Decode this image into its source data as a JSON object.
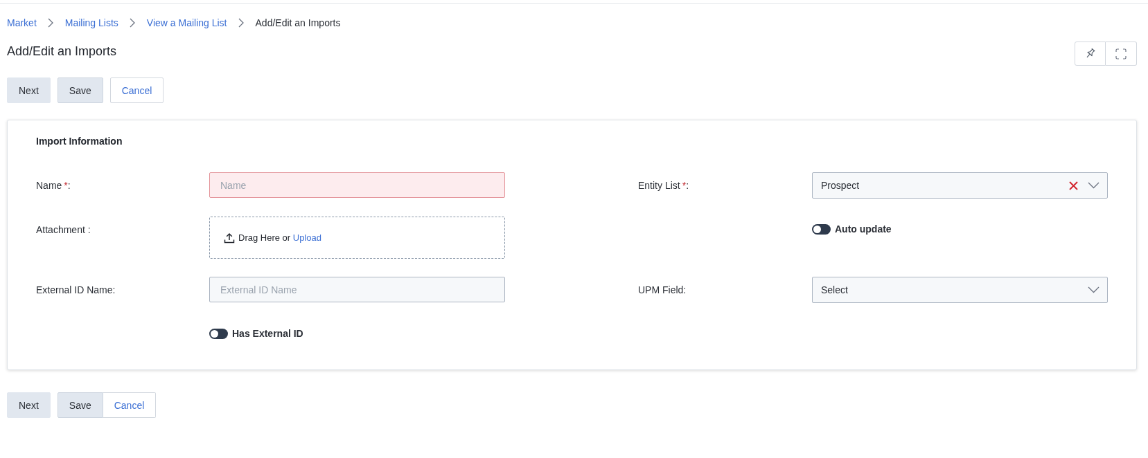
{
  "breadcrumb": [
    {
      "label": "Market",
      "current": false
    },
    {
      "label": "Mailing Lists",
      "current": false
    },
    {
      "label": "View a Mailing List",
      "current": false
    },
    {
      "label": "Add/Edit an Imports",
      "current": true
    }
  ],
  "page_title": "Add/Edit an Imports",
  "top_actions": [
    {
      "label": "Next",
      "kind": "plain"
    },
    {
      "label": "Save",
      "kind": "secondary"
    },
    {
      "label": "Cancel",
      "kind": "outline"
    }
  ],
  "form": {
    "title": "Import Information",
    "rows": [
      [
        {
          "kind": "text",
          "label": "Name",
          "required_mark": "*",
          "label_end": ":",
          "placeholder": "Name",
          "invalid": true
        },
        {
          "kind": "select",
          "label": "Entity List",
          "required_mark": "*",
          "label_end": ":",
          "value": "Prospect",
          "clearable": true
        }
      ],
      [
        {
          "kind": "upload",
          "label": "Attachment :",
          "prompt": "Drag Here or",
          "link": "Upload"
        },
        {
          "kind": "toggle",
          "label": "Auto update",
          "on": false
        }
      ],
      [
        {
          "kind": "text",
          "label": "External ID Name:",
          "placeholder": "External ID Name",
          "invalid": false
        },
        {
          "kind": "select",
          "label": "UPM Field:",
          "value": "Select",
          "clearable": false
        }
      ],
      [
        {
          "kind": "toggle",
          "label": "Has External ID",
          "on": false
        }
      ]
    ]
  },
  "bottom_actions": [
    {
      "label": "Next",
      "kind": "plain"
    },
    {
      "kind": "group",
      "buttons": [
        {
          "label": "Save",
          "kind": "secondary"
        },
        {
          "label": "Cancel",
          "kind": "outline"
        }
      ]
    }
  ]
}
